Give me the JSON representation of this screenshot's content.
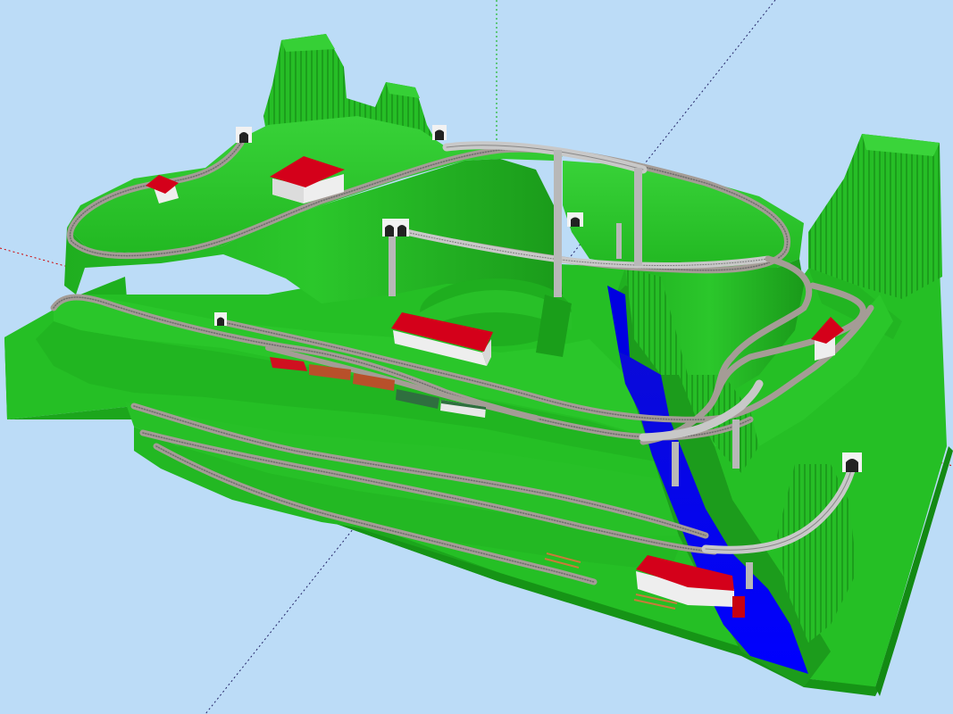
{
  "scene": {
    "kind": "3d-model-railway-layout",
    "view": "perspective",
    "colors": {
      "sky": "#bcdcf7",
      "terrain": "#27c427",
      "terrain_dark": "#1a9e1a",
      "terrain_light": "#45d845",
      "cliff": "#20b520",
      "water": "#0000f0",
      "track_ballast": "#a8a09a",
      "track_rail": "#6a6a6a",
      "bridge": "#c8c8c8",
      "pier": "#b8b8b8",
      "roof": "#d4001a",
      "wall": "#eeeeee",
      "tunnel_portal": "#f2f2f2",
      "tunnel_mouth": "#222222",
      "axis_red": "#d00000",
      "axis_green": "#00a000",
      "axis_blue": "#0000c0"
    },
    "objects": {
      "buildings": [
        "house",
        "large-house",
        "station-building",
        "trackside-hut",
        "goods-shed"
      ],
      "tunnels": 6,
      "train": {
        "locomotive_color": "#d01020",
        "coaches": [
          "#b8502a",
          "#b8502a",
          "#2f6f3f",
          "#2f6f3f"
        ]
      }
    }
  }
}
